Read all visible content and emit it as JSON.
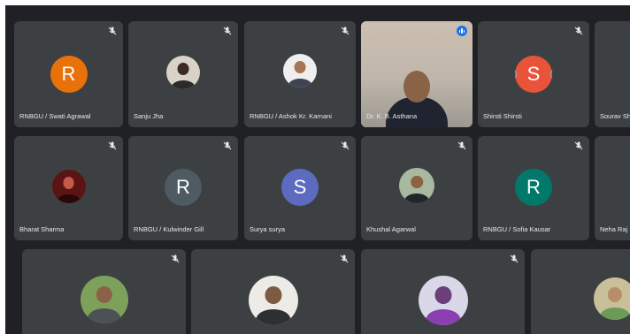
{
  "participants": {
    "swati": {
      "name": "RNBGU / Swati Agrawal",
      "initial": "R",
      "avatar_color": "#e8710a"
    },
    "sanju": {
      "name": "Sanju Jha"
    },
    "ashok": {
      "name": "RNBGU / Ashok Kr. Karnani"
    },
    "asthana": {
      "name": "Dr. K. B. Asthana"
    },
    "shirsti": {
      "name": "Shirsti Shirsti",
      "initial": "S",
      "avatar_color": "#e8533a"
    },
    "sourav": {
      "name": "Sourav Sh"
    },
    "bharat": {
      "name": "Bharat Sharma"
    },
    "kulwinder": {
      "name": "RNBGU / Kulwinder Gill",
      "initial": "R",
      "avatar_color": "#4f5b62"
    },
    "surya": {
      "name": "Surya surya",
      "initial": "S",
      "avatar_color": "#5c6bc0"
    },
    "khushal": {
      "name": "Khushal Agarwal"
    },
    "sofia": {
      "name": "RNBGU / Sofia Kausar",
      "initial": "R",
      "avatar_color": "#00796b"
    },
    "neha": {
      "name": "Neha Raj"
    }
  },
  "icons": {
    "mute": "microphone-off-icon",
    "speaking": "audio-level-icon"
  }
}
